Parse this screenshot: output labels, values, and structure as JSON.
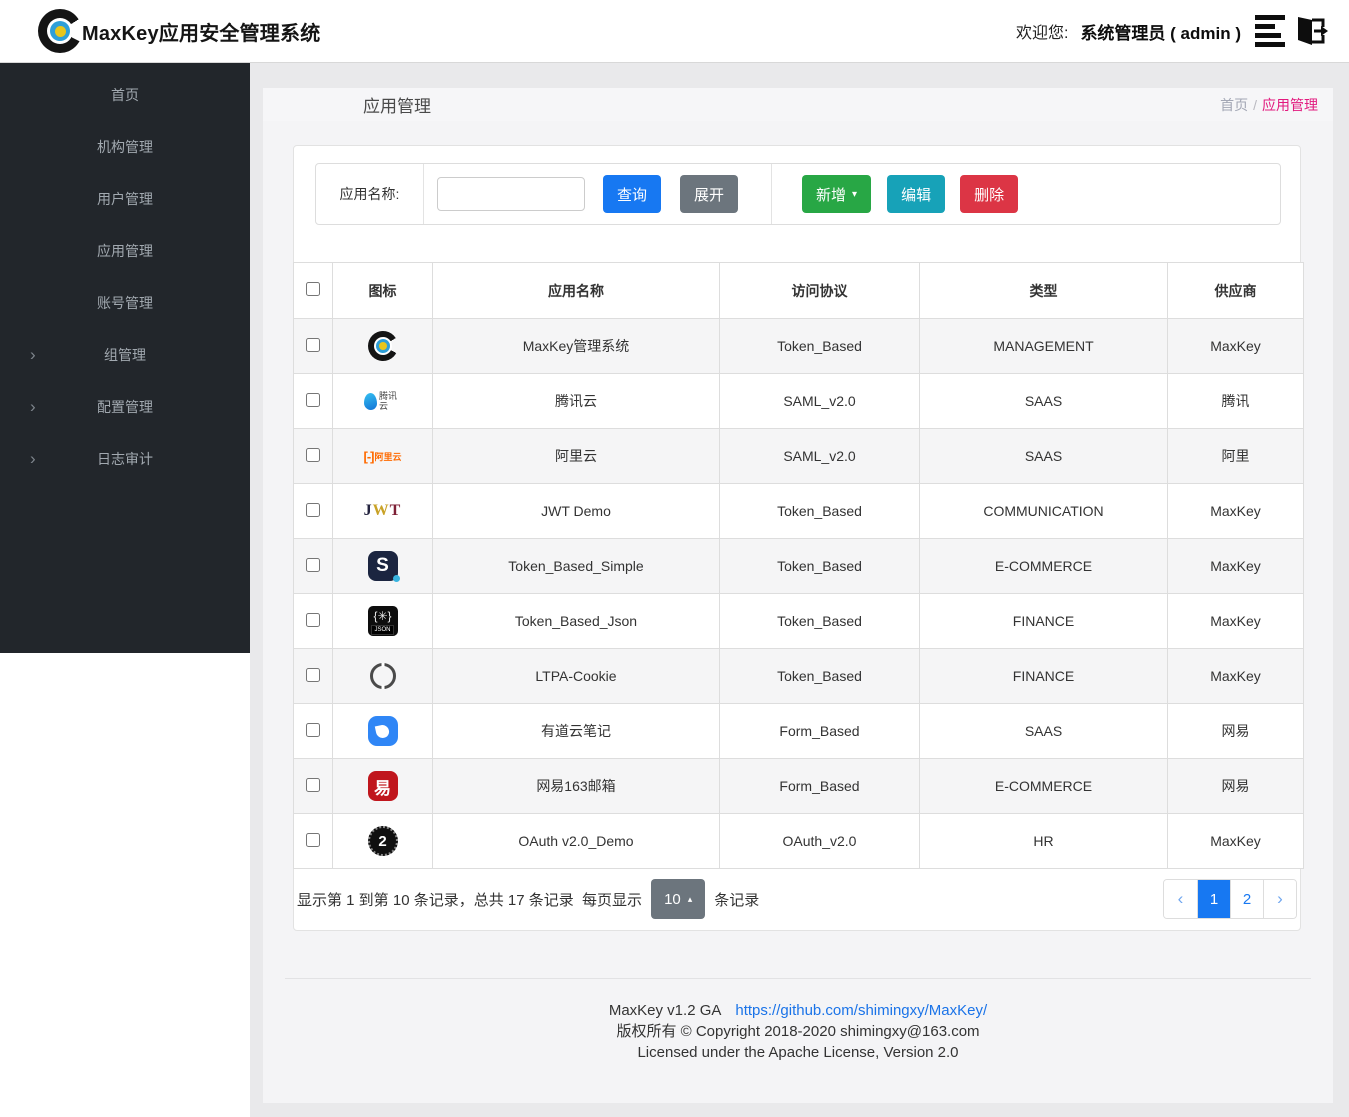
{
  "navbar": {
    "title": "MaxKey应用安全管理系统",
    "welcome": "欢迎您:",
    "username": "系统管理员 ( admin )"
  },
  "sidebar": {
    "items": [
      {
        "label": "首页",
        "expandable": false
      },
      {
        "label": "机构管理",
        "expandable": false
      },
      {
        "label": "用户管理",
        "expandable": false
      },
      {
        "label": "应用管理",
        "expandable": false
      },
      {
        "label": "账号管理",
        "expandable": false
      },
      {
        "label": "组管理",
        "expandable": true
      },
      {
        "label": "配置管理",
        "expandable": true
      },
      {
        "label": "日志审计",
        "expandable": true
      }
    ]
  },
  "breadcrumb": {
    "page_title": "应用管理",
    "home": "首页",
    "separator": "/",
    "current": "应用管理"
  },
  "toolbar": {
    "search_label": "应用名称:",
    "search_value": "",
    "query_label": "查询",
    "expand_label": "展开",
    "add_label": "新增",
    "edit_label": "编辑",
    "delete_label": "删除"
  },
  "table": {
    "headers": [
      "图标",
      "应用名称",
      "访问协议",
      "类型",
      "供应商"
    ],
    "rows": [
      {
        "icon": "maxkey-logo-icon",
        "name": "MaxKey管理系统",
        "protocol": "Token_Based",
        "type": "MANAGEMENT",
        "vendor": "MaxKey"
      },
      {
        "icon": "tencent-cloud-icon",
        "icon_text": "腾讯云",
        "name": "腾讯云",
        "protocol": "SAML_v2.0",
        "type": "SAAS",
        "vendor": "腾讯"
      },
      {
        "icon": "aliyun-icon",
        "icon_mark": "[-]",
        "icon_text": "阿里云",
        "name": "阿里云",
        "protocol": "SAML_v2.0",
        "type": "SAAS",
        "vendor": "阿里"
      },
      {
        "icon": "jwt-icon",
        "icon_letters": [
          "J",
          "W",
          "T"
        ],
        "name": "JWT Demo",
        "protocol": "Token_Based",
        "type": "COMMUNICATION",
        "vendor": "MaxKey"
      },
      {
        "icon": "token-simple-icon",
        "icon_text": "S",
        "name": "Token_Based_Simple",
        "protocol": "Token_Based",
        "type": "E-COMMERCE",
        "vendor": "MaxKey"
      },
      {
        "icon": "json-icon",
        "icon_text": "{✳}",
        "icon_label": "JSON",
        "name": "Token_Based_Json",
        "protocol": "Token_Based",
        "type": "FINANCE",
        "vendor": "MaxKey"
      },
      {
        "icon": "ltpa-ring-icon",
        "name": "LTPA-Cookie",
        "protocol": "Token_Based",
        "type": "FINANCE",
        "vendor": "MaxKey"
      },
      {
        "icon": "youdao-note-icon",
        "name": "有道云笔记",
        "protocol": "Form_Based",
        "type": "SAAS",
        "vendor": "网易"
      },
      {
        "icon": "netease-163-icon",
        "icon_text": "易",
        "name": "网易163邮箱",
        "protocol": "Form_Based",
        "type": "E-COMMERCE",
        "vendor": "网易"
      },
      {
        "icon": "oauth2-icon",
        "icon_text": "2",
        "name": "OAuth v2.0_Demo",
        "protocol": "OAuth_v2.0",
        "type": "HR",
        "vendor": "MaxKey"
      }
    ]
  },
  "pagination": {
    "info_prefix": "显示第 1 到第 10 条记录，总共 17 条记录  每页显示",
    "page_size": "10",
    "unit": "条记录",
    "pages": [
      "1",
      "2"
    ],
    "active_page": "1"
  },
  "footer": {
    "version": "MaxKey  v1.2 GA",
    "link": "https://github.com/shimingxy/MaxKey/",
    "copyright": "版权所有 © Copyright 2018-2020 shimingxy@163.com",
    "license": "Licensed under the Apache License, Version 2.0"
  },
  "colors": {
    "primary": "#1778f2",
    "secondary": "#6c757d",
    "success": "#28a745",
    "info": "#17a2b8",
    "danger": "#dc3545",
    "breadcrumb_active": "#e2197e",
    "sidebar_bg": "#22262b",
    "link": "#1a73e8"
  }
}
